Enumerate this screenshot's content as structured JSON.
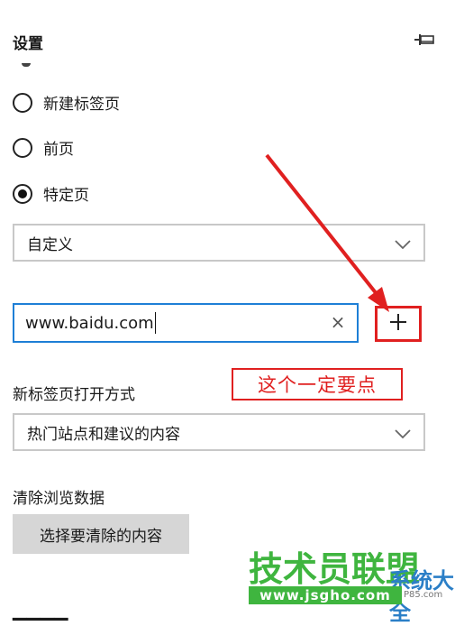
{
  "header": {
    "title": "设置"
  },
  "startup": {
    "options": [
      {
        "label": "新建标签页",
        "selected": false
      },
      {
        "label": "前页",
        "selected": false
      },
      {
        "label": "特定页",
        "selected": true
      }
    ],
    "page_select": {
      "value": "自定义"
    },
    "url_input": {
      "value": "www.baidu.com"
    },
    "add_icon": "plus-icon",
    "annotation": "这个一定要点"
  },
  "newtab": {
    "label": "新标签页打开方式",
    "select_value": "热门站点和建议的内容"
  },
  "clear_data": {
    "label": "清除浏览数据",
    "button_label": "选择要清除的内容"
  },
  "watermark": {
    "main": "技术员联盟",
    "secondary": "系统大全",
    "url": "www.jsgho.com",
    "small": "P85.com"
  },
  "colors": {
    "accent_blue": "#1e7fd6",
    "annotation_red": "#e02020",
    "watermark_green": "#3fb53f"
  }
}
